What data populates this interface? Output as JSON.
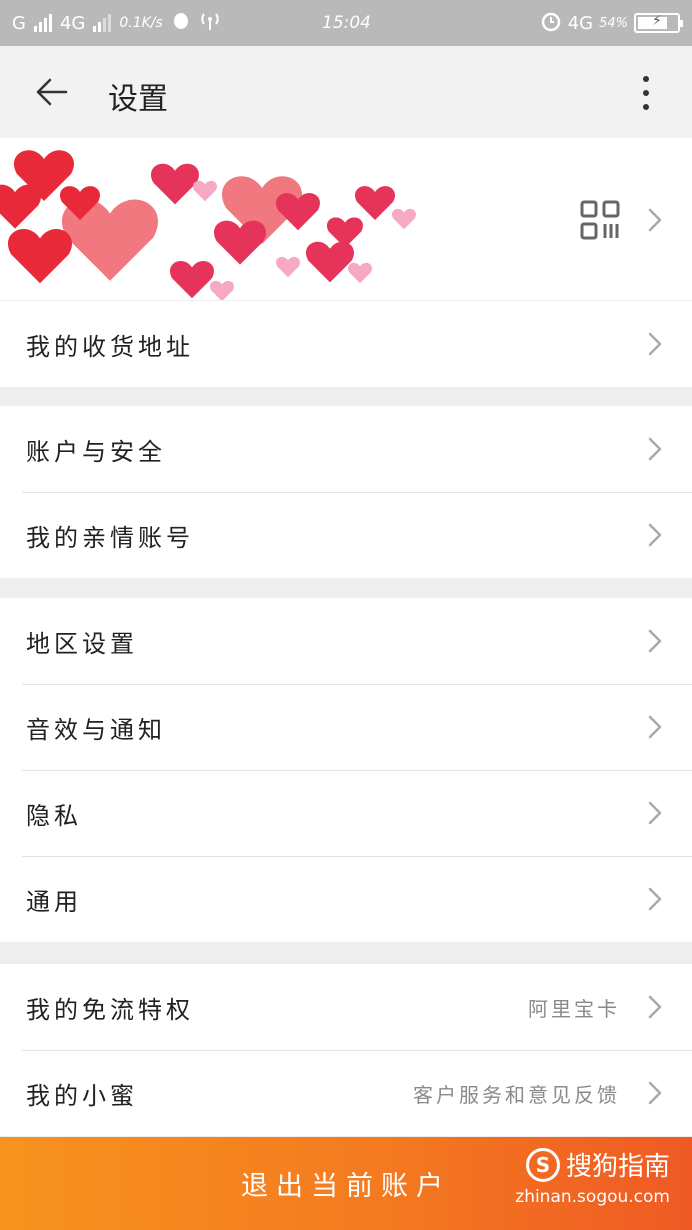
{
  "status_bar": {
    "carrier1": "G",
    "carrier2": "4G",
    "speed": "0.1K/s",
    "time": "15:04",
    "network": "4G",
    "battery": "54%"
  },
  "app_bar": {
    "title": "设置"
  },
  "icons": {
    "back": "back-arrow-icon",
    "more": "more-vertical-icon",
    "qr": "qr-code-icon",
    "chevron": "chevron-right-icon"
  },
  "profile": {
    "avatar": "avatar"
  },
  "groups": [
    {
      "items": [
        {
          "label": "我的收货地址",
          "sub": ""
        }
      ]
    },
    {
      "items": [
        {
          "label": "账户与安全",
          "sub": ""
        },
        {
          "label": "我的亲情账号",
          "sub": ""
        }
      ]
    },
    {
      "items": [
        {
          "label": "地区设置",
          "sub": ""
        },
        {
          "label": "音效与通知",
          "sub": ""
        },
        {
          "label": "隐私",
          "sub": ""
        },
        {
          "label": "通用",
          "sub": ""
        }
      ]
    },
    {
      "items": [
        {
          "label": "我的免流特权",
          "sub": "阿里宝卡"
        },
        {
          "label": "我的小蜜",
          "sub": "客户服务和意见反馈"
        }
      ]
    }
  ],
  "logout": {
    "label": "退出当前账户"
  },
  "watermark": {
    "brand": "搜狗指南",
    "url": "zhinan.sogou.com"
  },
  "colors": {
    "accent_orange": "#f47a20",
    "status_bar": "#b9b9b9",
    "background": "#eeeeee"
  }
}
